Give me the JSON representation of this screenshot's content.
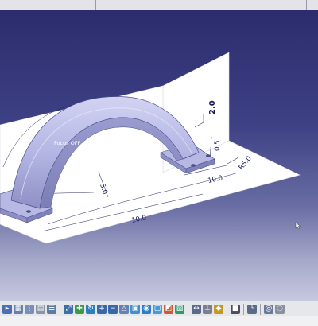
{
  "viewport": {
    "annotations": {
      "focus_upper": "Focus OFF",
      "focus_lower": "Focus OFF"
    },
    "dimensions": {
      "d1": "2.0",
      "d2": "0.5",
      "d3": "R5.0",
      "d4": "10.0",
      "d5": "5.0",
      "d6": "10.0"
    },
    "colors": {
      "background_top": "#2b2c6e",
      "background_bottom": "#c6c8de",
      "part_color": "#b9bbe6",
      "sketch_plane": "#ffffff"
    }
  },
  "toolbar": {
    "items": [
      {
        "icon": "select-arrow-icon",
        "glyph": "▸",
        "color": "#4a6fb5"
      },
      {
        "icon": "table-icon",
        "glyph": "▦",
        "color": "#6b7fa8"
      },
      {
        "icon": "tree-icon",
        "glyph": "⋮",
        "color": "#7a8fb8"
      },
      {
        "icon": "paste-icon",
        "glyph": "▤",
        "color": "#8a94a6"
      },
      {
        "icon": "parameters-icon",
        "glyph": "☰",
        "color": "#5f7aa0"
      },
      {
        "sep": true
      },
      {
        "icon": "fit-all-icon",
        "glyph": "⤢",
        "color": "#3d6fa8"
      },
      {
        "icon": "pan-icon",
        "glyph": "✚",
        "color": "#3b9b4b"
      },
      {
        "icon": "rotate-icon",
        "glyph": "↻",
        "color": "#2f7fbf"
      },
      {
        "icon": "zoom-in-icon",
        "glyph": "+",
        "color": "#3a67a8"
      },
      {
        "icon": "zoom-out-icon",
        "glyph": "−",
        "color": "#3a67a8"
      },
      {
        "icon": "normal-view-icon",
        "glyph": "△",
        "color": "#6b7fb5"
      },
      {
        "icon": "iso-view-icon",
        "glyph": "▣",
        "color": "#3f8fd1"
      },
      {
        "icon": "shading-icon",
        "glyph": "◉",
        "color": "#2e7fc9"
      },
      {
        "icon": "wireframe-icon",
        "glyph": "▢",
        "color": "#4a9ad8"
      },
      {
        "icon": "hide-show-icon",
        "glyph": "◩",
        "color": "#c45e3a"
      },
      {
        "icon": "swap-visible-icon",
        "glyph": "▧",
        "color": "#2f9a6e"
      },
      {
        "sep": true
      },
      {
        "icon": "constraint-icon",
        "glyph": "↔",
        "color": "#5a6a8a"
      },
      {
        "icon": "measure-icon",
        "glyph": "⊥",
        "color": "#7a7f92"
      },
      {
        "icon": "material-icon",
        "glyph": "◆",
        "color": "#c49a22"
      },
      {
        "sep": true
      },
      {
        "icon": "catalog-icon",
        "glyph": "■",
        "color": "#4b4f5c"
      },
      {
        "sep": true
      },
      {
        "icon": "axis-icon",
        "glyph": "└",
        "color": "#5b6b88"
      },
      {
        "sep": true
      },
      {
        "icon": "spiral-icon",
        "glyph": "@",
        "color": "#6a7a98"
      },
      {
        "icon": "dress-up-icon",
        "glyph": "◌",
        "color": "#8a8fa0"
      }
    ]
  }
}
